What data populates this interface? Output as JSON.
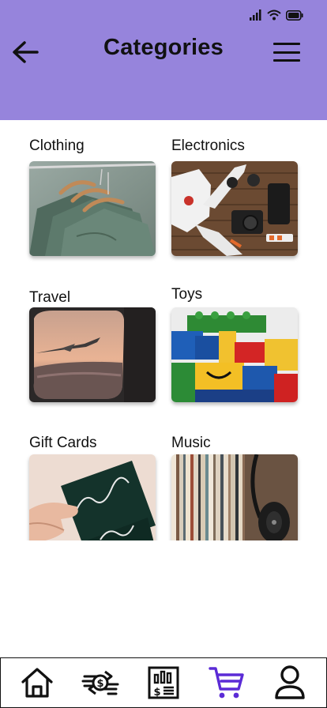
{
  "header": {
    "title": "Categories",
    "background": "#9684dc"
  },
  "status_bar": {
    "icons": [
      "cellular-signal-icon",
      "wifi-icon",
      "battery-icon"
    ]
  },
  "categories": [
    {
      "label": "Clothing",
      "image": "clothes-on-hangers"
    },
    {
      "label": "Electronics",
      "image": "drone-and-camera-gear"
    },
    {
      "label": "Travel",
      "image": "airplane-window-view"
    },
    {
      "label": "Toys",
      "image": "building-bricks"
    },
    {
      "label": "Gift Cards",
      "image": "thanks-card-in-hand"
    },
    {
      "label": "Music",
      "image": "vinyl-records-and-headphones"
    }
  ],
  "bottom_nav": {
    "items": [
      "home-icon",
      "exchange-money-icon",
      "bills-icon",
      "cart-icon",
      "profile-icon"
    ],
    "active": "cart-icon",
    "active_color": "#5b2bd6"
  }
}
